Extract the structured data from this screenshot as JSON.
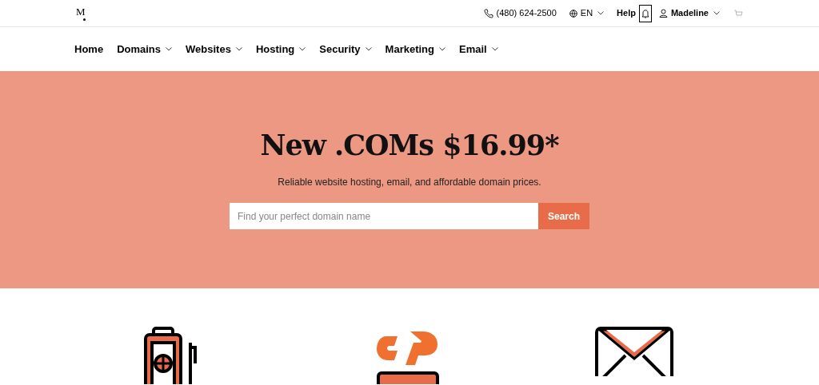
{
  "logo": {
    "letter": "M"
  },
  "top_bar": {
    "phone": "(480) 624-2500",
    "language": "EN",
    "help": "Help",
    "user": "Madeline"
  },
  "nav": [
    {
      "label": "Home",
      "has_menu": false
    },
    {
      "label": "Domains",
      "has_menu": true
    },
    {
      "label": "Websites",
      "has_menu": true
    },
    {
      "label": "Hosting",
      "has_menu": true
    },
    {
      "label": "Security",
      "has_menu": true
    },
    {
      "label": "Marketing",
      "has_menu": true
    },
    {
      "label": "Email",
      "has_menu": true
    }
  ],
  "hero": {
    "title": "New .COMs $16.99*",
    "subtitle": "Reliable website hosting, email, and affordable domain prices.",
    "search": {
      "placeholder": "Find your perfect domain name",
      "button": "Search"
    }
  },
  "features": [
    {
      "kind": "travel"
    },
    {
      "kind": "panel"
    },
    {
      "kind": "mail"
    }
  ]
}
